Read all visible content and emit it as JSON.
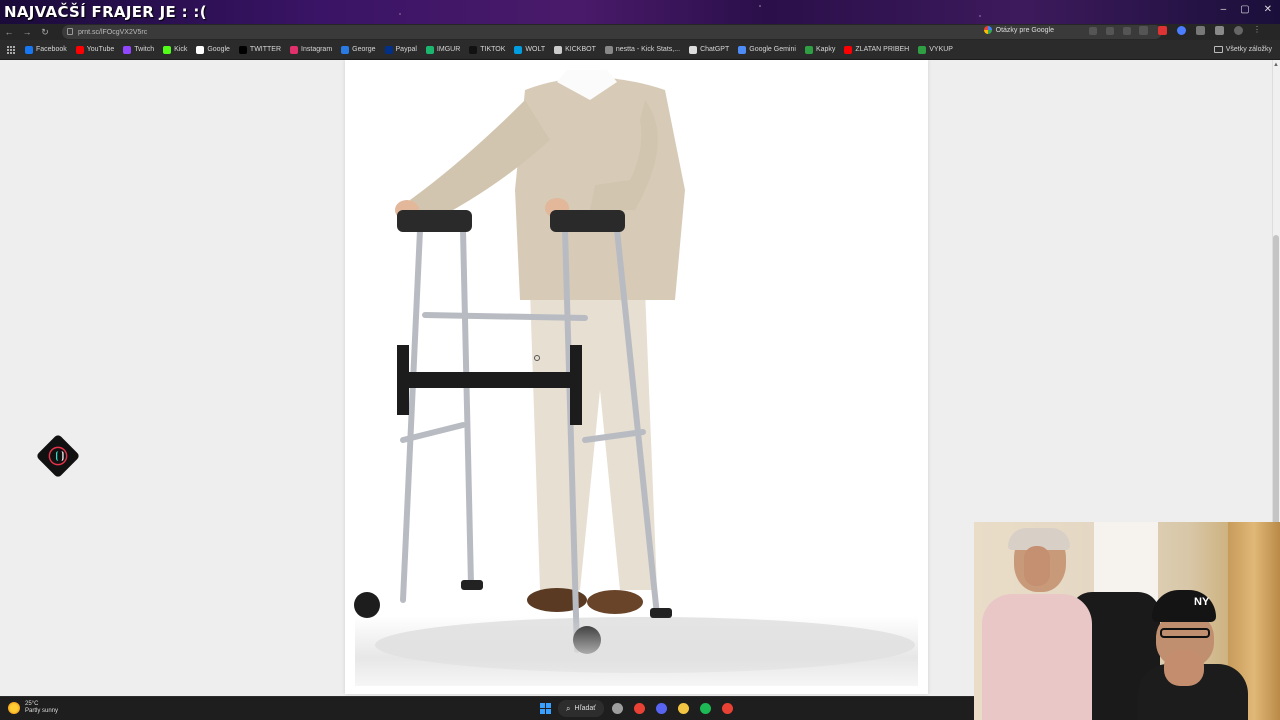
{
  "stream": {
    "title": "NAJVAČŠÍ FRAJER JE :  :("
  },
  "window_controls": [
    "–",
    "▢",
    "✕"
  ],
  "browser": {
    "url": "prnt.sc/lFOcgVX2V5rc",
    "google_button": "Otázky pre Google"
  },
  "bookmarks": {
    "items": [
      {
        "label": "Facebook",
        "color": "#1877f2"
      },
      {
        "label": "YouTube",
        "color": "#ff0000"
      },
      {
        "label": "Twitch",
        "color": "#9146ff"
      },
      {
        "label": "Kick",
        "color": "#53fc18"
      },
      {
        "label": "Google",
        "color": "#ffffff"
      },
      {
        "label": "TWITTER",
        "color": "#000000"
      },
      {
        "label": "Instagram",
        "color": "#e1306c"
      },
      {
        "label": "George",
        "color": "#2a7ae4"
      },
      {
        "label": "Paypal",
        "color": "#003087"
      },
      {
        "label": "IMGUR",
        "color": "#1bb76e"
      },
      {
        "label": "TIKTOK",
        "color": "#111111"
      },
      {
        "label": "WOLT",
        "color": "#009de0"
      },
      {
        "label": "KICKBOT",
        "color": "#cccccc"
      },
      {
        "label": "nestta - Kick Stats,...",
        "color": "#888888"
      },
      {
        "label": "ChatGPT",
        "color": "#dddddd"
      },
      {
        "label": "Google Gemini",
        "color": "#4e8cf7"
      },
      {
        "label": "Kapky",
        "color": "#2ea043"
      },
      {
        "label": "ZLATAN PRIBEH",
        "color": "#ff0000"
      },
      {
        "label": "VYKUP",
        "color": "#2ea043"
      }
    ],
    "all_bookmarks": "Všetky záložky"
  },
  "taskbar": {
    "weather_temp": "25°C",
    "weather_desc": "Partly sunny",
    "search_label": "Hľadať",
    "apps": [
      {
        "name": "file-explorer",
        "color": "#9e9e9e"
      },
      {
        "name": "chrome",
        "color": "#e94235"
      },
      {
        "name": "discord",
        "color": "#5865f2"
      },
      {
        "name": "folder",
        "color": "#f4c542"
      },
      {
        "name": "spotify",
        "color": "#1db954"
      },
      {
        "name": "obs",
        "color": "#e94235"
      }
    ]
  },
  "webcam": {
    "cap_logo": "NY"
  }
}
